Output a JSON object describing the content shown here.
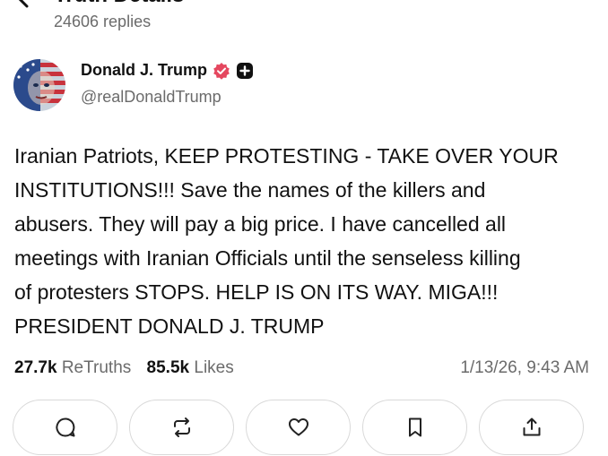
{
  "header": {
    "title": "Truth Details",
    "replies": "24606 replies"
  },
  "author": {
    "name": "Donald J. Trump",
    "handle": "@realDonaldTrump"
  },
  "post": {
    "lines": [
      "Iranian Patriots, KEEP PROTESTING - TAKE OVER YOUR",
      "INSTITUTIONS!!! Save the names of the killers and",
      "abusers. They will pay a big price. I have cancelled all",
      "meetings with Iranian Officials until the senseless killing",
      "of protesters STOPS. HELP IS ON ITS WAY. MIGA!!!",
      "PRESIDENT DONALD J. TRUMP"
    ]
  },
  "stats": {
    "retruths_count": "27.7k",
    "retruths_label": "ReTruths",
    "likes_count": "85.5k",
    "likes_label": "Likes",
    "timestamp": "1/13/26, 9:43 AM"
  },
  "icons": {
    "back": "back-arrow-icon",
    "verified": "verified-badge-icon",
    "plus": "plus-icon",
    "reply": "comment-icon",
    "retruth": "repost-icon",
    "like": "heart-icon",
    "bookmark": "bookmark-icon",
    "share": "share-icon"
  },
  "colors": {
    "verified": "#e5475f",
    "text": "#111111",
    "muted": "#6b6b6b",
    "border": "#d9d9d9"
  }
}
